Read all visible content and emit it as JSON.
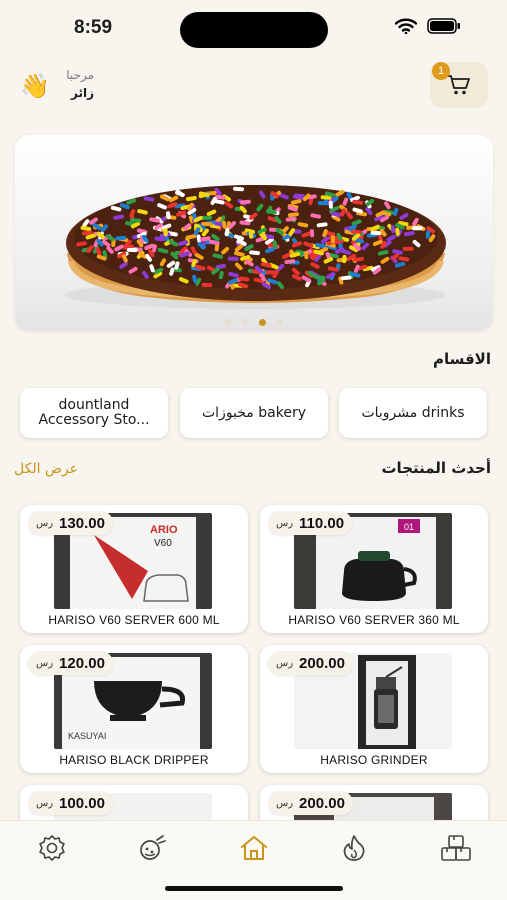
{
  "status_bar": {
    "time": "8:59"
  },
  "header": {
    "cart_count": "1",
    "greeting": "مرحبا",
    "user_name": "زائر"
  },
  "banner": {
    "slide_count": 4,
    "active_slide": 3
  },
  "categories": {
    "title": "الاقسام",
    "items": [
      {
        "label": "مشروبات drinks"
      },
      {
        "label": "مخبوزات bakery"
      },
      {
        "label": "dountland Accessory Sto..."
      }
    ]
  },
  "latest": {
    "title": "أحدث المنتجات",
    "view_all": "عرض الكل",
    "currency": "رس",
    "products": [
      {
        "name": "HARISO V60 SERVER 360 ML",
        "price": "110.00"
      },
      {
        "name": "HARISO V60 SERVER 600 ML",
        "price": "130.00"
      },
      {
        "name": "HARISO GRINDER",
        "price": "200.00"
      },
      {
        "name": "HARISO BLACK DRIPPER",
        "price": "120.00"
      },
      {
        "name": "",
        "price": "200.00"
      },
      {
        "name": "",
        "price": "100.00"
      }
    ]
  },
  "tabbar": {
    "active": "home",
    "accent_color": "#c9941e",
    "items": [
      {
        "icon": "boxes-icon"
      },
      {
        "icon": "fire-icon"
      },
      {
        "icon": "home-icon"
      },
      {
        "icon": "tea-icon"
      },
      {
        "icon": "gear-icon"
      }
    ]
  }
}
